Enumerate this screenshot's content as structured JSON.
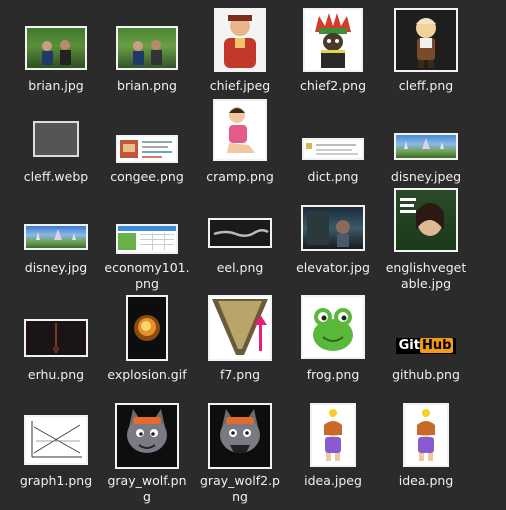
{
  "files": [
    {
      "name": "brian.jpg"
    },
    {
      "name": "brian.png"
    },
    {
      "name": "chief.jpeg"
    },
    {
      "name": "chief2.png"
    },
    {
      "name": "cleff.png"
    },
    {
      "name": "cleff.webp"
    },
    {
      "name": "congee.png"
    },
    {
      "name": "cramp.png"
    },
    {
      "name": "dict.png"
    },
    {
      "name": "disney.jpeg"
    },
    {
      "name": "disney.jpg"
    },
    {
      "name": "economy101.png"
    },
    {
      "name": "eel.png"
    },
    {
      "name": "elevator.jpg"
    },
    {
      "name": "englishvegetable.jpg"
    },
    {
      "name": "erhu.png"
    },
    {
      "name": "explosion.gif"
    },
    {
      "name": "f7.png"
    },
    {
      "name": "frog.png"
    },
    {
      "name": "github.png"
    },
    {
      "name": "graph1.png"
    },
    {
      "name": "gray_wolf.png"
    },
    {
      "name": "gray_wolf2.png"
    },
    {
      "name": "idea.jpeg"
    },
    {
      "name": "idea.png"
    }
  ],
  "github_logo": {
    "left": "Git",
    "right": "Hub"
  }
}
